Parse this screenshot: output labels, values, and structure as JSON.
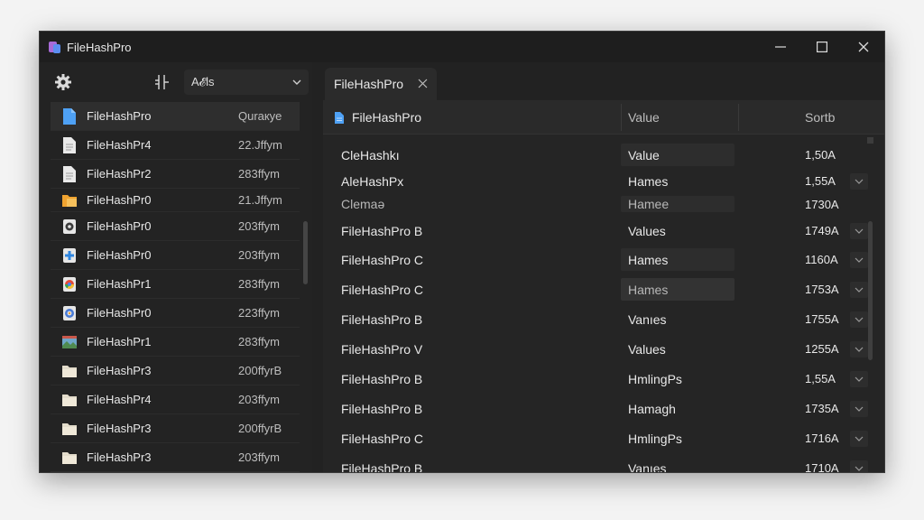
{
  "window": {
    "title": "FileHashPro"
  },
  "title_controls": {
    "minimize": "minimize",
    "maximize": "maximize",
    "close": "close"
  },
  "left_toolbar": {
    "filter_value": "A𝓔ls"
  },
  "file_list": [
    {
      "name": "FileHashPro",
      "meta": "Quraкye",
      "icon": "blue-doc-icon",
      "selected": true
    },
    {
      "name": "FileHashPr4",
      "meta": "22.Jffym",
      "icon": "text-doc-icon"
    },
    {
      "name": "FileHashPr2",
      "meta": "283ffym",
      "icon": "text-doc-icon"
    },
    {
      "name": "FileHashPr0",
      "meta": "21.Jffym",
      "icon": "orange-folder-icon"
    },
    {
      "name": "FileHashPr0",
      "meta": "203ffym",
      "icon": "gear-doc-icon"
    },
    {
      "name": "FileHashPr0",
      "meta": "203ffym",
      "icon": "blue-plus-doc-icon"
    },
    {
      "name": "FileHashPr1",
      "meta": "283ffym",
      "icon": "chrome-doc-icon"
    },
    {
      "name": "FileHashPr0",
      "meta": "223ffym",
      "icon": "chrome-doc-icon"
    },
    {
      "name": "FileHashPr1",
      "meta": "283ffym",
      "icon": "image-doc-icon"
    },
    {
      "name": "FileHashPr3",
      "meta": "200ffyrB",
      "icon": "folder-icon"
    },
    {
      "name": "FileHashPr4",
      "meta": "203ffym",
      "icon": "folder-icon"
    },
    {
      "name": "FileHashPr3",
      "meta": "200ffyrB",
      "icon": "folder-icon"
    },
    {
      "name": "FileHashPr3",
      "meta": "203ffym",
      "icon": "folder-icon"
    }
  ],
  "tab": {
    "label": "FileHashPro"
  },
  "grid": {
    "headers": {
      "file": "FileHashPro",
      "value": "Value",
      "sort": "Sortb"
    },
    "rows": [
      {
        "name": "CleHashkı",
        "value": "Value",
        "size": "1,50A"
      },
      {
        "name": "AleHashPx",
        "value": "Hames",
        "size": "1,55A"
      },
      {
        "name": "Clemaə",
        "value": "Hamee",
        "size": "1730A",
        "muted": true
      },
      {
        "name": "FileHashPro B",
        "value": "Values",
        "size": "1749A"
      },
      {
        "name": "FileHashPro C",
        "value": "Hames",
        "size": "1160A"
      },
      {
        "name": "FileHashPro C",
        "value": "Hames",
        "size": "1753A",
        "muted_value": true
      },
      {
        "name": "FileHashPro B",
        "value": "Vanıes",
        "size": "1755A"
      },
      {
        "name": "FileHashPro V",
        "value": "Values",
        "size": "1255A"
      },
      {
        "name": "FileHashPro B",
        "value": "HmlingPs",
        "size": "1,55A"
      },
      {
        "name": "FileHashPro B",
        "value": "Hamagh",
        "size": "1735A"
      },
      {
        "name": "FileHashPro C",
        "value": "HmlingPs",
        "size": "1716A"
      },
      {
        "name": "FileHashPro B",
        "value": "Vanıes",
        "size": "1710A"
      }
    ]
  }
}
